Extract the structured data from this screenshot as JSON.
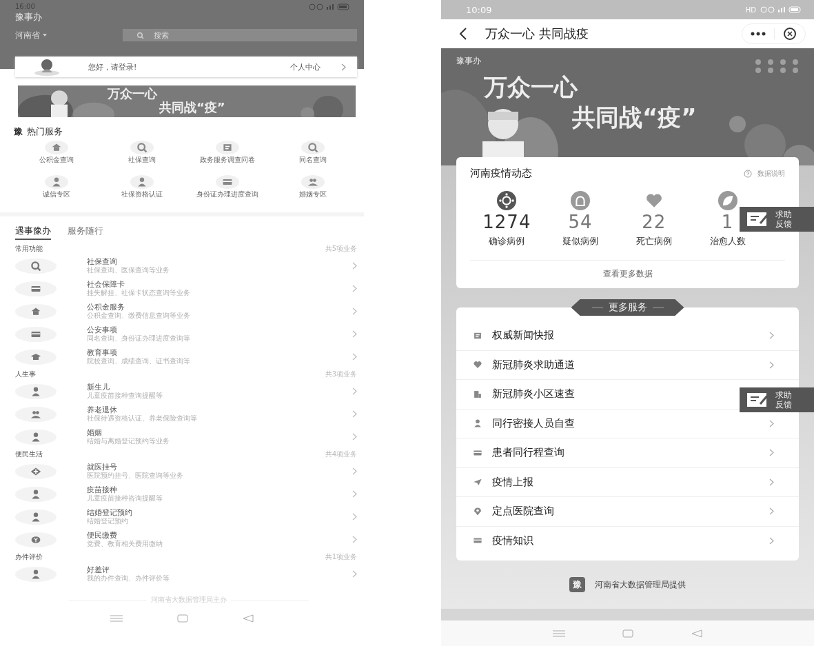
{
  "left_screen": {
    "status_bar": {
      "time": "16:00"
    },
    "app_title": "豫事办",
    "region": "河南省",
    "search": {
      "placeholder": "搜索"
    },
    "login_card": {
      "greeting": "您好，请登录!",
      "link": "个人中心"
    },
    "banner": {
      "line_1": "万众一心",
      "line_2": "共同战“疫”"
    },
    "hot_services": {
      "logo": "豫",
      "title": "热门服务",
      "items": [
        {
          "label": "公积金查询"
        },
        {
          "label": "社保查询"
        },
        {
          "label": "政务服务调查问卷"
        },
        {
          "label": "同名查询"
        },
        {
          "label": "诚信专区"
        },
        {
          "label": "社保资格认证"
        },
        {
          "label": "身份证办理进度查询"
        },
        {
          "label": "婚姻专区"
        }
      ]
    },
    "tabs": [
      {
        "label": "遇事豫办",
        "selected": true
      },
      {
        "label": "服务随行",
        "selected": false
      }
    ],
    "sections": [
      {
        "title": "常用功能",
        "count": "共5项业务",
        "items": [
          {
            "title": "社保查询",
            "subtitle": "社保查询、医保查询等业务"
          },
          {
            "title": "社会保障卡",
            "subtitle": "挂失解挂、社保卡状态查询等业务"
          },
          {
            "title": "公积金服务",
            "subtitle": "公积金查询、缴费信息查询等业务"
          },
          {
            "title": "公安事项",
            "subtitle": "同名查询、身份证办理进度查询等"
          },
          {
            "title": "教育事项",
            "subtitle": "院校查询、成绩查询、证书查询等"
          }
        ]
      },
      {
        "title": "人生事",
        "count": "共3项业务",
        "items": [
          {
            "title": "新生儿",
            "subtitle": "儿童疫苗接种查询提醒等"
          },
          {
            "title": "养老退休",
            "subtitle": "社保待遇资格认证、养老保险查询等"
          },
          {
            "title": "婚姻",
            "subtitle": "结婚与离婚登记预约等业务"
          }
        ]
      },
      {
        "title": "便民生活",
        "count": "共4项业务",
        "items": [
          {
            "title": "就医挂号",
            "subtitle": "医院预约挂号、医院查询等业务"
          },
          {
            "title": "疫苗接种",
            "subtitle": "儿童疫苗接种咨询提醒等"
          },
          {
            "title": "结婚登记预约",
            "subtitle": "结婚登记预约"
          },
          {
            "title": "便民缴费",
            "subtitle": "党费、教育相关费用缴纳"
          }
        ]
      },
      {
        "title": "办件评价",
        "count": "共1项业务",
        "items": [
          {
            "title": "好差评",
            "subtitle": "我的办件查询、办件评价等"
          }
        ]
      }
    ],
    "footer": "河南省大数据管理局主办"
  },
  "right_screen": {
    "status_bar": {
      "time": "10:09",
      "network": "HD"
    },
    "title": "万众一心 共同战疫",
    "banner": {
      "logo": "豫事办",
      "line_1": "万众一心",
      "line_2": "共同战“疫”"
    },
    "epidemic_card": {
      "title": "河南疫情动态",
      "help_link": "数据说明",
      "stats": [
        {
          "value": "1274",
          "label": "确诊病例"
        },
        {
          "value": "54",
          "label": "疑似病例"
        },
        {
          "value": "22",
          "label": "死亡病例"
        },
        {
          "value": "1",
          "label": "治愈人数"
        }
      ],
      "more_link": "查看更多数据"
    },
    "more_services": {
      "title": "更多服务",
      "items": [
        {
          "label": "权威新闻快报"
        },
        {
          "label": "新冠肺炎求助通道"
        },
        {
          "label": "新冠肺炎小区速查"
        },
        {
          "label": "同行密接人员自查"
        },
        {
          "label": "患者同行程查询"
        },
        {
          "label": "疫情上报"
        },
        {
          "label": "定点医院查询"
        },
        {
          "label": "疫情知识"
        }
      ]
    },
    "feedback_buttons": [
      {
        "label": "求助反馈"
      },
      {
        "label": "求助反馈"
      }
    ],
    "footer": {
      "logo": "豫",
      "text": "河南省大数据管理局提供"
    }
  }
}
